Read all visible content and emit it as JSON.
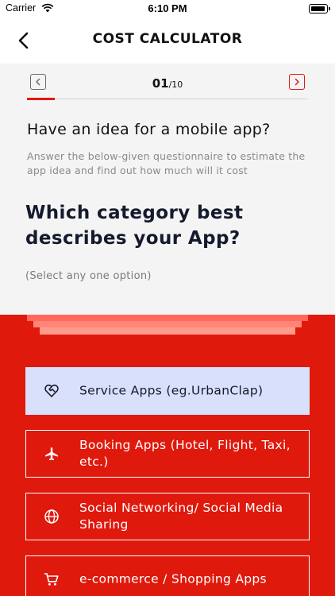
{
  "status_bar": {
    "carrier": "Carrier",
    "time": "6:10 PM"
  },
  "nav": {
    "title": "COST CALCULATOR",
    "back_icon": "chevron-left-icon"
  },
  "pager": {
    "current": "01",
    "total": "/10",
    "progress": 0.1
  },
  "intro": {
    "heading": "Have an idea for a mobile app?",
    "subtext": "Answer the below-given questionnaire to estimate the app idea and find out how much will it cost"
  },
  "question": {
    "title": "Which category best describes your App?",
    "hint": "(Select any one option)"
  },
  "options": [
    {
      "label": "Service Apps (eg.UrbanClap)",
      "icon": "heart-handshake-icon",
      "selected": true
    },
    {
      "label": "Booking Apps (Hotel, Flight, Taxi, etc.)",
      "icon": "airplane-icon",
      "selected": false
    },
    {
      "label": "Social Networking/ Social Media Sharing",
      "icon": "globe-icon",
      "selected": false
    },
    {
      "label": "e-commerce / Shopping Apps",
      "icon": "shopping-cart-icon",
      "selected": false
    }
  ],
  "colors": {
    "accent": "#e0190d",
    "selected_bg": "#d9e0fb",
    "grey_bg": "#f4f4f5"
  }
}
